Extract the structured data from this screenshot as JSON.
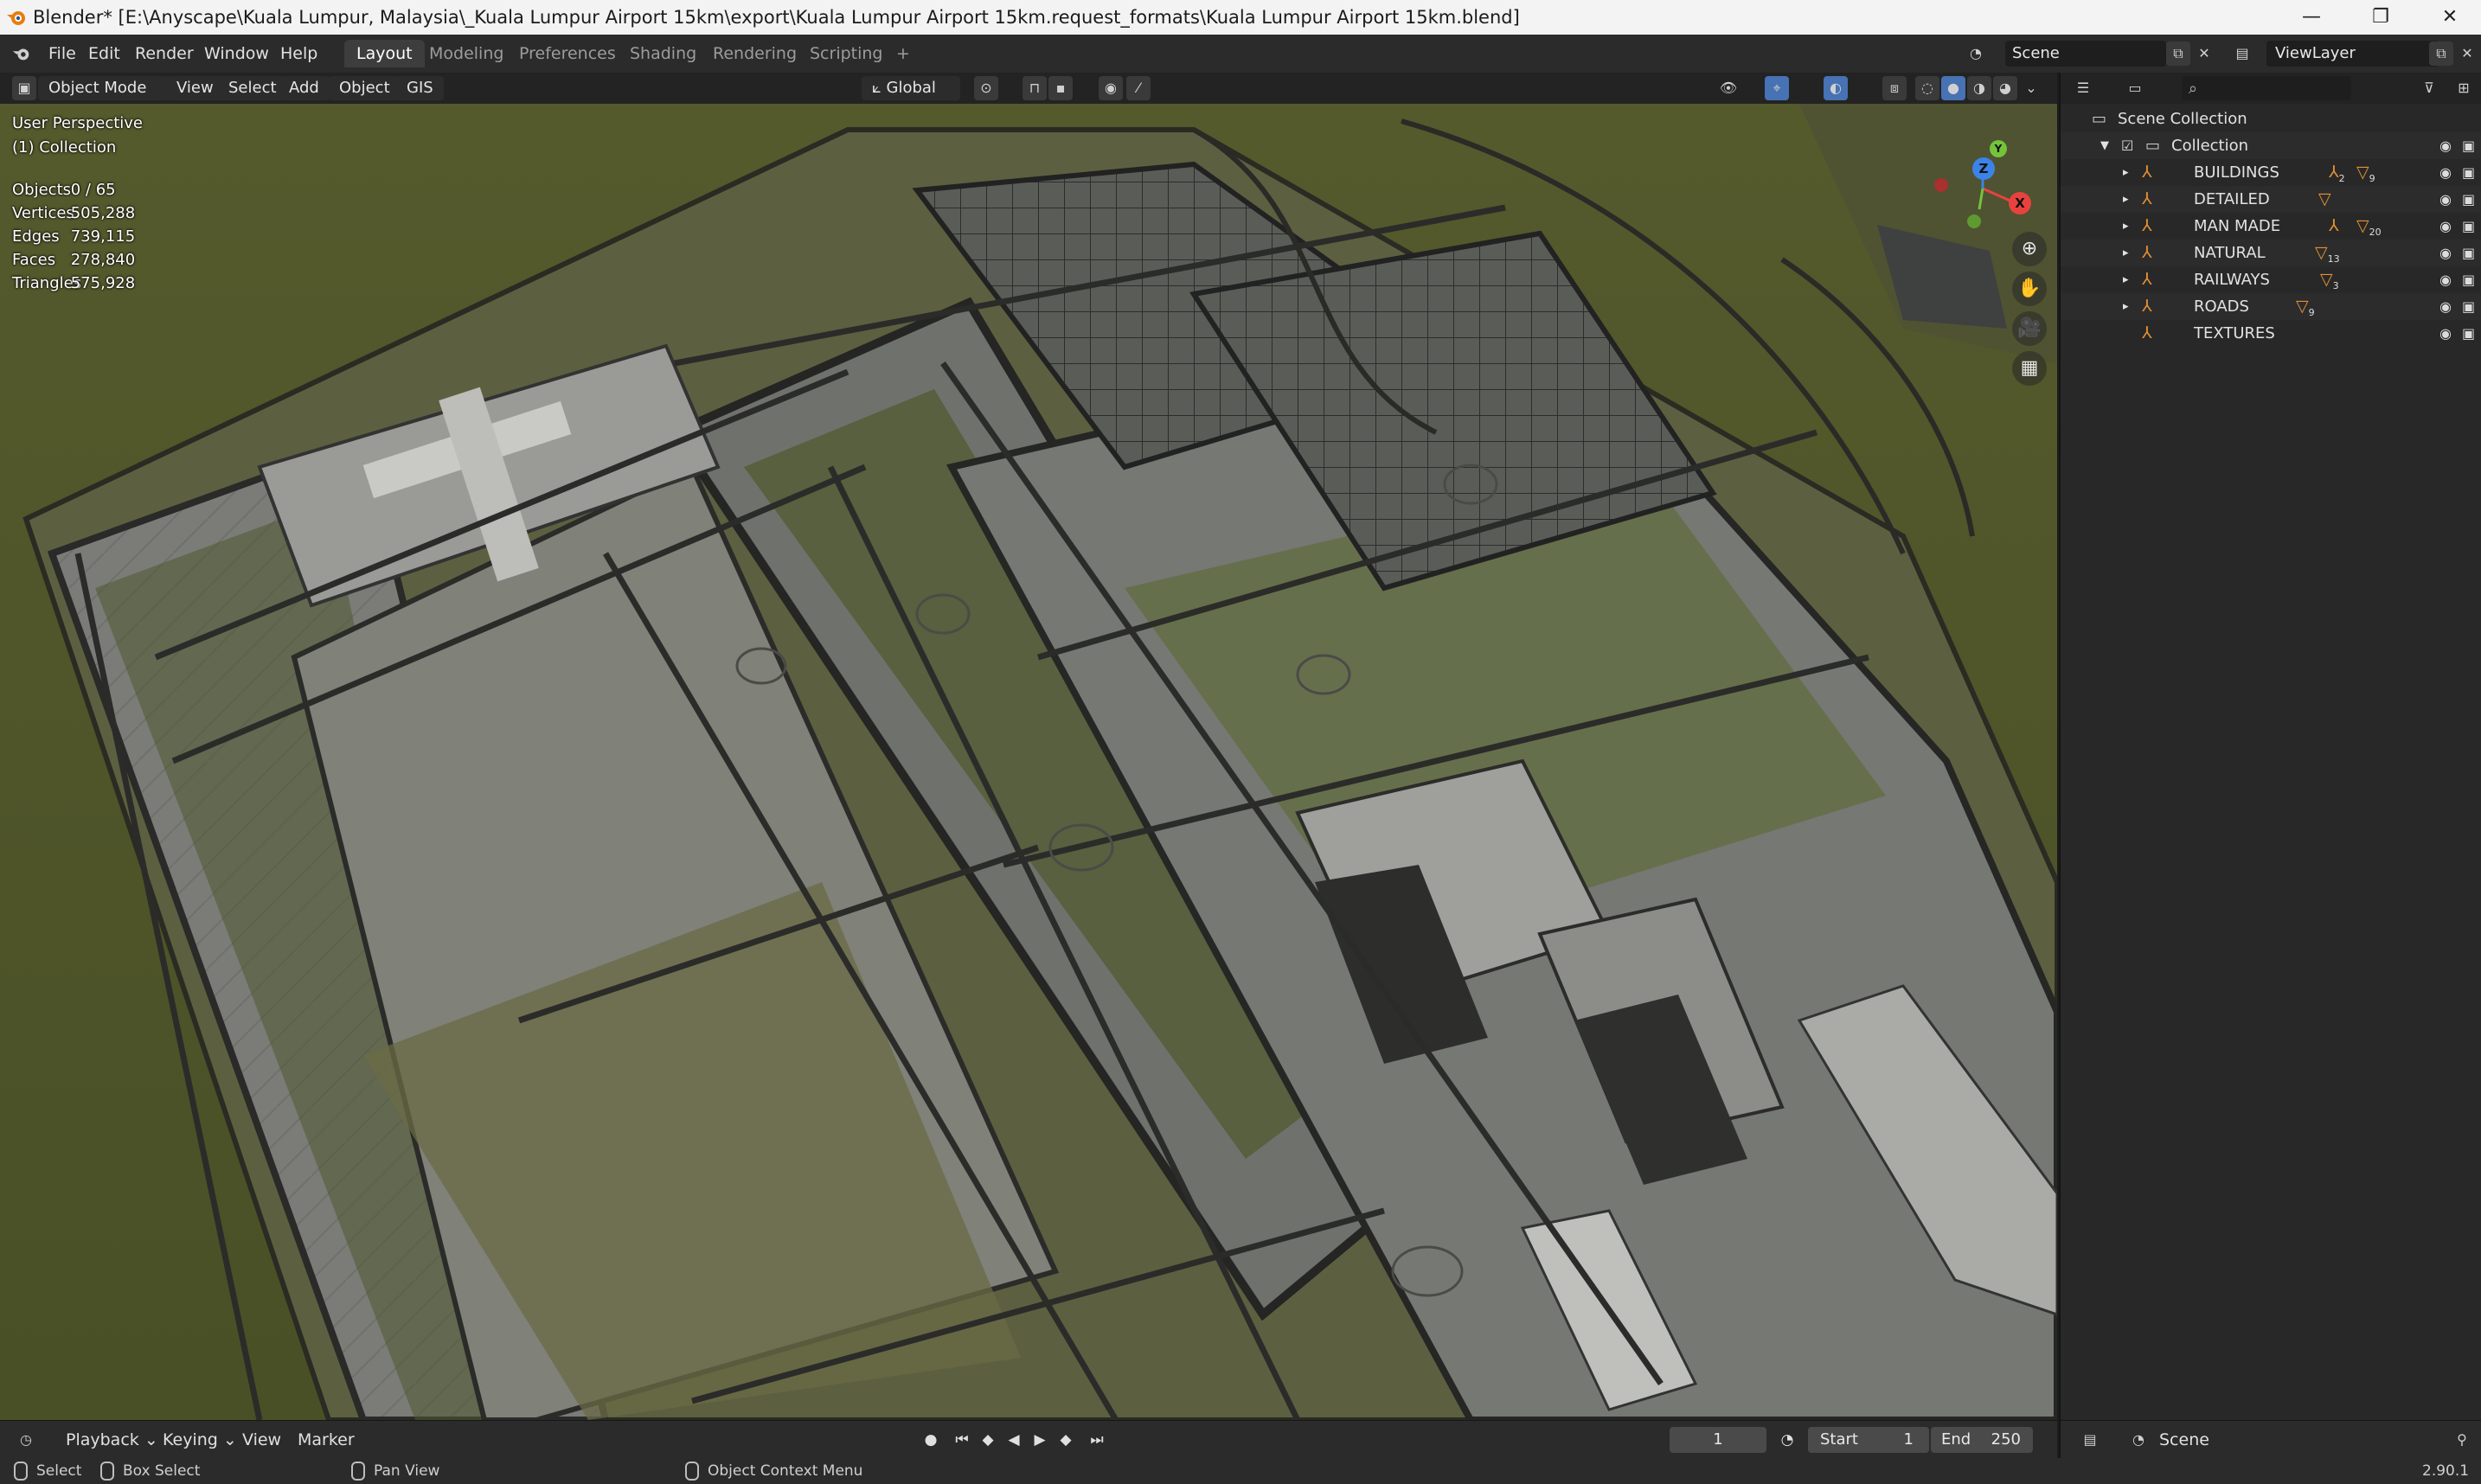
{
  "window": {
    "title": "Blender* [E:\\Anyscape\\Kuala Lumpur, Malaysia\\_Kuala Lumpur Airport 15km\\export\\Kuala Lumpur Airport 15km.request_formats\\Kuala Lumpur Airport 15km.blend]",
    "minimize": "—",
    "maximize": "❐",
    "close": "✕"
  },
  "menu": {
    "items": [
      "File",
      "Edit",
      "Render",
      "Window",
      "Help"
    ],
    "workspaces": [
      "Layout",
      "Modeling",
      "Preferences",
      "Shading",
      "Rendering",
      "Scripting"
    ],
    "add_workspace": "+",
    "active_workspace": "Layout",
    "scene": "Scene",
    "view_layer": "ViewLayer"
  },
  "viewport_header": {
    "mode": "Object Mode",
    "menus": [
      "View",
      "Select",
      "Add",
      "Object",
      "GIS"
    ],
    "orientation": "Global"
  },
  "viewport": {
    "perspective": "User Perspective",
    "collection": "(1) Collection",
    "stats": [
      {
        "label": "Objects",
        "value": "0 / 65"
      },
      {
        "label": "Vertices",
        "value": "505,288"
      },
      {
        "label": "Edges",
        "value": "739,115"
      },
      {
        "label": "Faces",
        "value": "278,840"
      },
      {
        "label": "Triangles",
        "value": "575,928"
      }
    ],
    "gizmo": {
      "x": "X",
      "y": "Y",
      "z": "Z"
    }
  },
  "outliner": {
    "scene_collection": "Scene Collection",
    "collection": "Collection",
    "children": [
      {
        "name": "BUILDINGS",
        "badges": [
          "2",
          "9"
        ]
      },
      {
        "name": "DETAILED",
        "badges": [
          ""
        ]
      },
      {
        "name": "MAN MADE",
        "badges": [
          "",
          "20"
        ]
      },
      {
        "name": "NATURAL",
        "badges": [
          "13"
        ]
      },
      {
        "name": "RAILWAYS",
        "badges": [
          "3"
        ]
      },
      {
        "name": "ROADS",
        "badges": [
          "9"
        ]
      },
      {
        "name": "TEXTURES",
        "badges": []
      }
    ]
  },
  "timeline": {
    "menus": [
      "Playback",
      "Keying",
      "View",
      "Marker"
    ],
    "current_frame": "1",
    "start_label": "Start",
    "start": "1",
    "end_label": "End",
    "end": "250"
  },
  "properties": {
    "scene": "Scene"
  },
  "statusbar": {
    "select": "Select",
    "box_select": "Box Select",
    "pan_view": "Pan View",
    "context_menu": "Object Context Menu",
    "version": "2.90.1"
  },
  "colors": {
    "accent": "#4772b3",
    "collection_icon": "#e39035",
    "terrain": "#4e5128",
    "x_axis": "#e8423f",
    "y_axis": "#74c33b",
    "z_axis": "#3b83e8"
  }
}
